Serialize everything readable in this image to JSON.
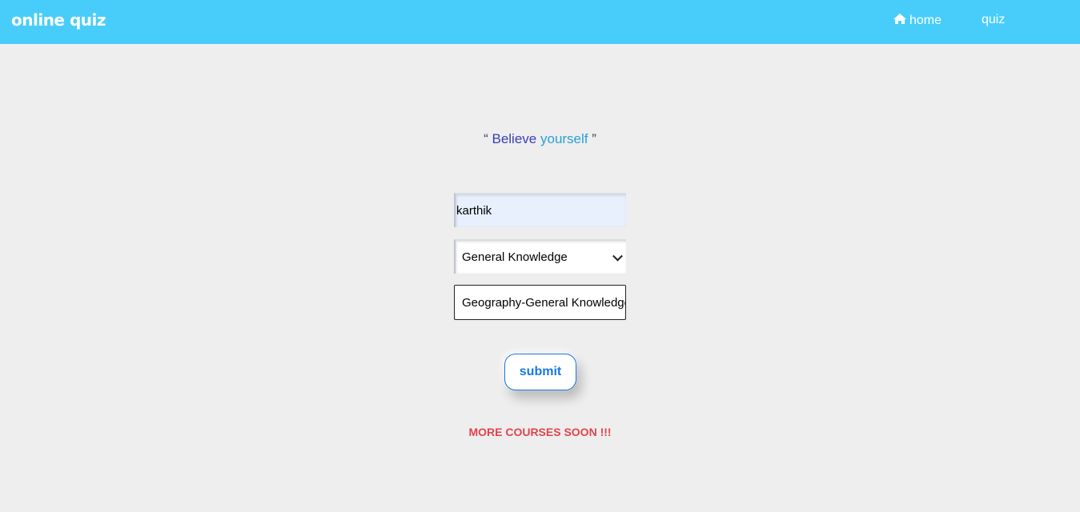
{
  "header": {
    "brand": "online quiz",
    "nav": {
      "home_label": "home",
      "home_icon": "home-icon",
      "quiz_label": "quiz"
    }
  },
  "quote": {
    "open": "“",
    "word1": "Believe",
    "word2": "yourself",
    "close": "”"
  },
  "form": {
    "name_value": "karthik",
    "category_selected": "General Knowledge",
    "topic_value": "Geography-General Knowledge",
    "submit_label": "submit"
  },
  "footer_note": "MORE COURSES SOON !!!",
  "colors": {
    "topbar": "#48cdfb",
    "background": "#eeeeee",
    "accent_blue": "#1877e6",
    "note_red": "#e0444d"
  }
}
